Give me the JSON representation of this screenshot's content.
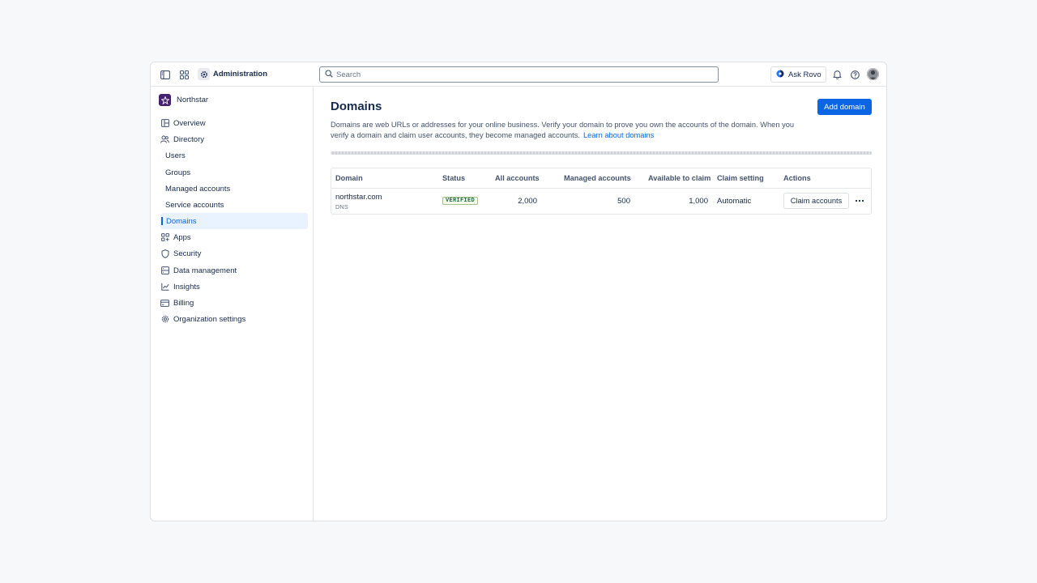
{
  "topbar": {
    "title": "Administration",
    "search_placeholder": "Search",
    "ask_rovo_label": "Ask Rovo"
  },
  "sidebar": {
    "org_name": "Northstar",
    "items": [
      {
        "label": "Overview",
        "icon": "overview-icon"
      },
      {
        "label": "Directory",
        "icon": "people-icon"
      },
      {
        "label": "Users"
      },
      {
        "label": "Groups"
      },
      {
        "label": "Managed accounts"
      },
      {
        "label": "Service accounts"
      },
      {
        "label": "Domains",
        "active": true
      },
      {
        "label": "Apps",
        "icon": "apps-icon"
      },
      {
        "label": "Security",
        "icon": "shield-icon"
      },
      {
        "label": "Data management",
        "icon": "database-icon"
      },
      {
        "label": "Insights",
        "icon": "chart-icon"
      },
      {
        "label": "Billing",
        "icon": "credit-card-icon"
      },
      {
        "label": "Organization settings",
        "icon": "gear-icon"
      }
    ]
  },
  "main": {
    "title": "Domains",
    "add_button": "Add domain",
    "description": "Domains are web URLs or addresses for your online business. Verify your domain to prove you own the accounts of the domain. When you verify a domain and claim user accounts, they become managed accounts.",
    "learn_link": "Learn about domains",
    "table": {
      "headers": [
        "Domain",
        "Status",
        "All accounts",
        "Managed accounts",
        "Available to claim",
        "Claim setting",
        "Actions"
      ],
      "rows": [
        {
          "domain": "northstar.com",
          "method": "DNS",
          "status": "VERIFIED",
          "all_accounts": "2,000",
          "managed_accounts": "500",
          "available_to_claim": "1,000",
          "claim_setting": "Automatic",
          "action": "Claim accounts",
          "more": "•••"
        }
      ]
    }
  },
  "colors": {
    "accent": "#0c66e4",
    "verified_text": "#216e4e",
    "org_logo": "#44226e"
  }
}
